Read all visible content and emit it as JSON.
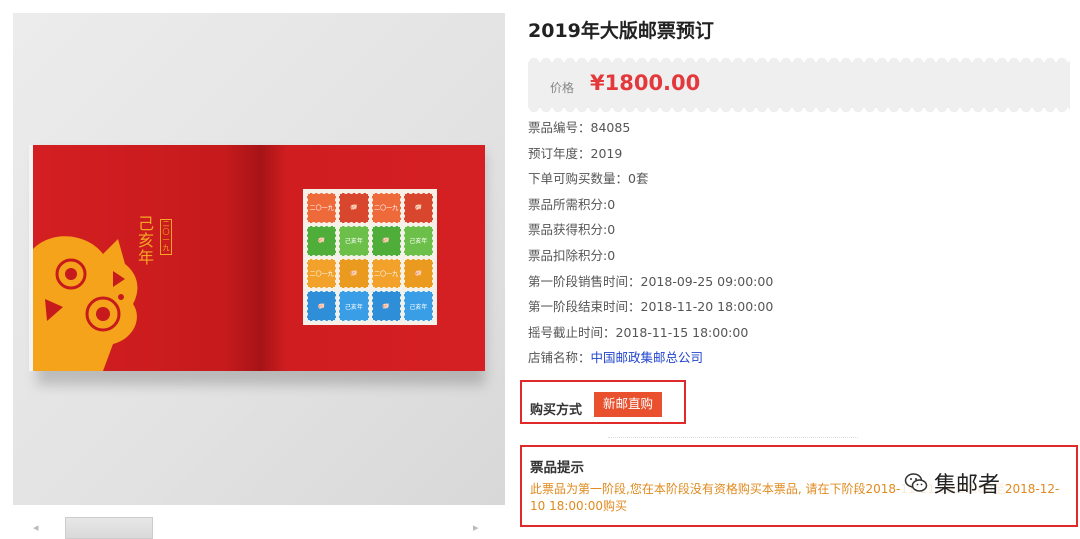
{
  "product": {
    "title": "2019年大版邮票预订",
    "price_label": "价格",
    "price": "¥1800.00"
  },
  "album_art": {
    "calligraphy": "己亥年",
    "box_text": "二〇一九",
    "stamp_text_a": "二〇一九",
    "stamp_text_b": "己亥年"
  },
  "attributes": [
    {
      "label": "票品编号：",
      "value": "84085"
    },
    {
      "label": "预订年度：",
      "value": "2019"
    },
    {
      "label": "下单可购买数量：",
      "value": "0套"
    },
    {
      "label": "票品所需积分:",
      "value": "0"
    },
    {
      "label": "票品获得积分:",
      "value": "0"
    },
    {
      "label": "票品扣除积分:",
      "value": "0"
    },
    {
      "label": "第一阶段销售时间：",
      "value": "2018-09-25 09:00:00"
    },
    {
      "label": "第一阶段结束时间：",
      "value": "2018-11-20 18:00:00"
    },
    {
      "label": "摇号截止时间：",
      "value": "2018-11-15 18:00:00"
    },
    {
      "label": "店铺名称：",
      "value": "中国邮政集邮总公司"
    }
  ],
  "purchase": {
    "label": "购买方式",
    "button": "新邮直购"
  },
  "notice": {
    "title": "票品提示",
    "text": "此票品为第一阶段,您在本阶段没有资格购买本票品, 请在下阶段2018-11-21 09:00:00至2018-12-10 18:00:00购买"
  },
  "watermark": {
    "text": "集邮者",
    "icon": "wechat-icon"
  },
  "colors": {
    "price": "#e4393c",
    "button": "#e8502e",
    "highlight_border": "#e02a2a",
    "notice_text": "#e08a1e",
    "link": "#2244cc",
    "album_red": "#d41f22",
    "gold": "#f6a823"
  }
}
